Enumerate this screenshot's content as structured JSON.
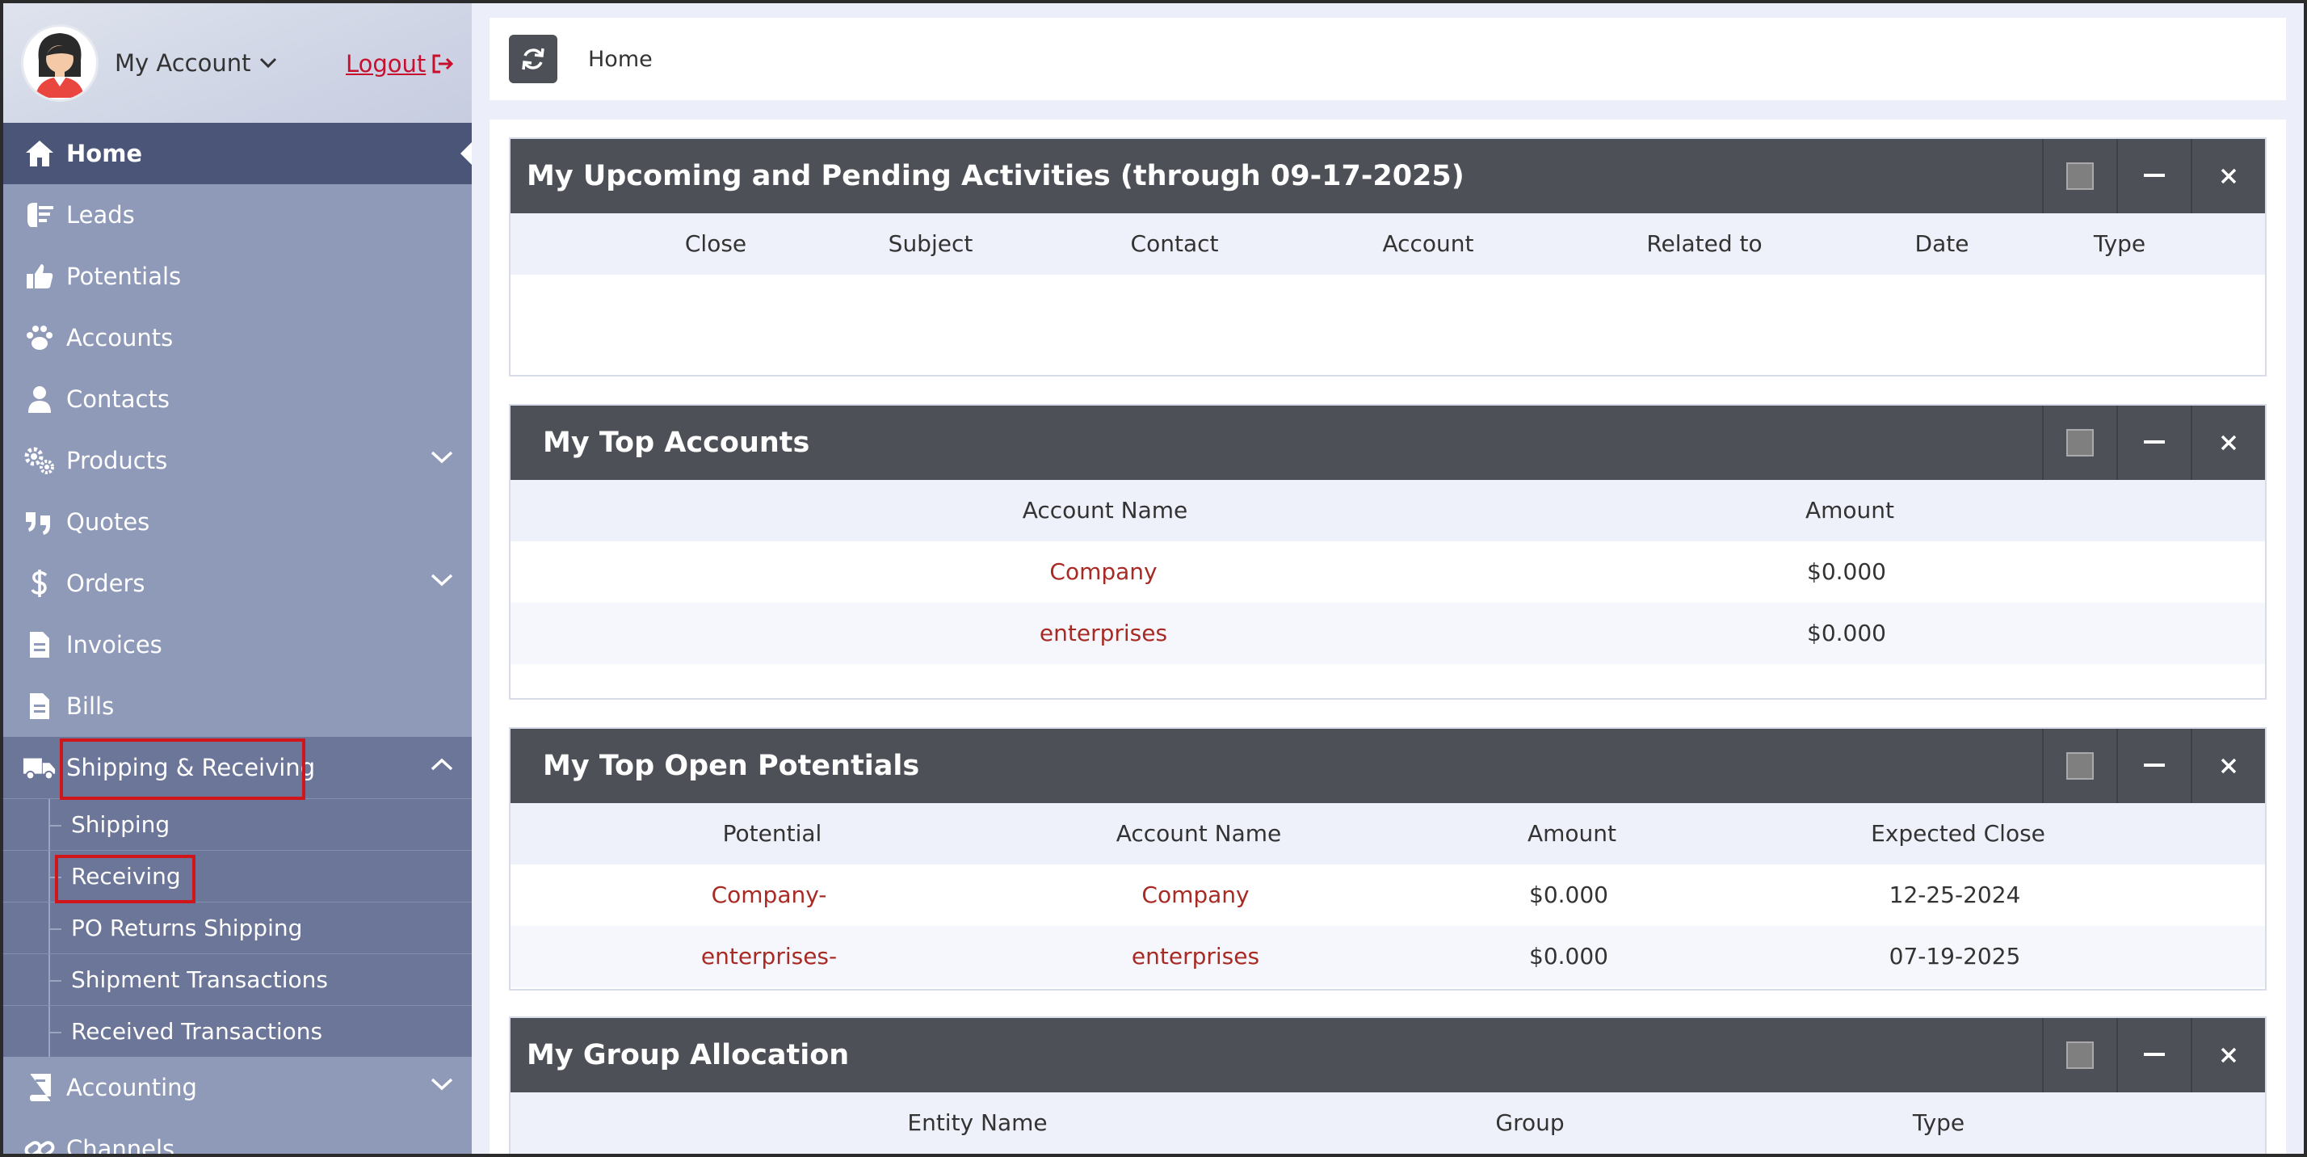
{
  "account": {
    "label": "My Account",
    "logout": "Logout"
  },
  "sidebar": {
    "items": [
      {
        "label": "Home",
        "icon": "home-icon"
      },
      {
        "label": "Leads",
        "icon": "leads-icon"
      },
      {
        "label": "Potentials",
        "icon": "thumbs-up-icon"
      },
      {
        "label": "Accounts",
        "icon": "paw-icon"
      },
      {
        "label": "Contacts",
        "icon": "user-icon"
      },
      {
        "label": "Products",
        "icon": "gears-icon"
      },
      {
        "label": "Quotes",
        "icon": "quote-icon"
      },
      {
        "label": "Orders",
        "icon": "dollar-icon"
      },
      {
        "label": "Invoices",
        "icon": "file-icon"
      },
      {
        "label": "Bills",
        "icon": "file-icon"
      },
      {
        "label": "Shipping & Receiving",
        "icon": "truck-icon"
      },
      {
        "label": "Accounting",
        "icon": "book-icon"
      },
      {
        "label": "Channels",
        "icon": "link-icon"
      }
    ],
    "sub_items": [
      "Shipping",
      "Receiving",
      "PO Returns Shipping",
      "Shipment Transactions",
      "Received Transactions"
    ]
  },
  "topbar": {
    "breadcrumb": "Home"
  },
  "widgets": {
    "activities": {
      "title": "My Upcoming and Pending Activities (through 09-17-2025)",
      "columns": [
        "Close",
        "Subject",
        "Contact",
        "Account",
        "Related to",
        "Date",
        "Type"
      ]
    },
    "top_accounts": {
      "title": "My Top Accounts",
      "columns": [
        "Account Name",
        "Amount"
      ],
      "rows": [
        {
          "name": "Company",
          "amount": "$0.000"
        },
        {
          "name": "enterprises",
          "amount": "$0.000"
        }
      ]
    },
    "top_potentials": {
      "title": "My Top Open Potentials",
      "columns": [
        "Potential",
        "Account Name",
        "Amount",
        "Expected Close"
      ],
      "rows": [
        {
          "potential": "Company-",
          "account": "Company",
          "amount": "$0.000",
          "close": "12-25-2024"
        },
        {
          "potential": "enterprises-",
          "account": "enterprises",
          "amount": "$0.000",
          "close": "07-19-2025"
        }
      ]
    },
    "group_allocation": {
      "title": "My Group Allocation",
      "columns": [
        "Entity Name",
        "Group",
        "Type"
      ]
    }
  },
  "colors": {
    "sidebar": "#8f99b8",
    "sidebar_active": "#4a5577",
    "sidebar_open": "#6c7698",
    "widget_header": "#4d5157",
    "link": "#a82a24",
    "highlight": "#d0151b"
  }
}
